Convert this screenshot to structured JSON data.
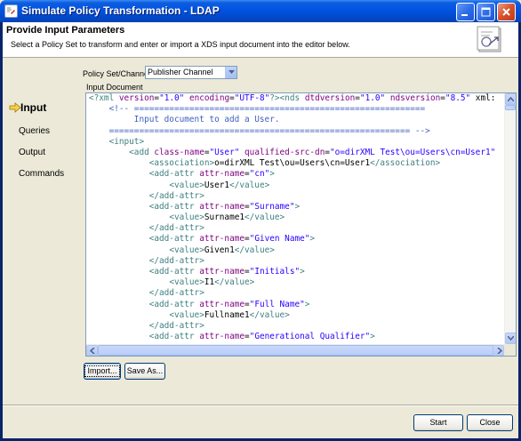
{
  "window": {
    "title": "Simulate Policy Transformation - LDAP",
    "app_icon": "policy-app-icon",
    "controls": [
      "minimize-icon",
      "maximize-icon",
      "close-icon"
    ]
  },
  "header": {
    "title": "Provide Input Parameters",
    "subtitle": "Select a Policy Set to transform and enter or import a XDS input document into the editor below.",
    "icon": "document-transform-icon"
  },
  "nav": {
    "items": [
      {
        "label": "Input",
        "active": true
      },
      {
        "label": "Queries",
        "active": false
      },
      {
        "label": "Output",
        "active": false
      },
      {
        "label": "Commands",
        "active": false
      }
    ],
    "active_marker_icon": "arrow-right-icon"
  },
  "policy": {
    "label": "Policy Set/Channel:",
    "selected": "Publisher Channel"
  },
  "editor": {
    "label": "Input Document",
    "lines": [
      "<?xml version=\"1.0\" encoding=\"UTF-8\"?><nds dtdversion=\"1.0\" ndsversion=\"8.5\" xml:",
      "    <!-- ==========================================================",
      "         Input document to add a User.",
      "    ============================================================ -->",
      "    <input>",
      "        <add class-name=\"User\" qualified-src-dn=\"o=dirXML Test\\ou=Users\\cn=User1\"",
      "            <association>o=dirXML Test\\ou=Users\\cn=User1</association>",
      "            <add-attr attr-name=\"cn\">",
      "                <value>User1</value>",
      "            </add-attr>",
      "            <add-attr attr-name=\"Surname\">",
      "                <value>Surname1</value>",
      "            </add-attr>",
      "            <add-attr attr-name=\"Given Name\">",
      "                <value>Given1</value>",
      "            </add-attr>",
      "            <add-attr attr-name=\"Initials\">",
      "                <value>I1</value>",
      "            </add-attr>",
      "            <add-attr attr-name=\"Full Name\">",
      "                <value>Fullname1</value>",
      "            </add-attr>",
      "            <add-attr attr-name=\"Generational Qualifier\">"
    ]
  },
  "buttons": {
    "import": "Import...",
    "save_as": "Save As...",
    "start": "Start",
    "close": "Close"
  }
}
